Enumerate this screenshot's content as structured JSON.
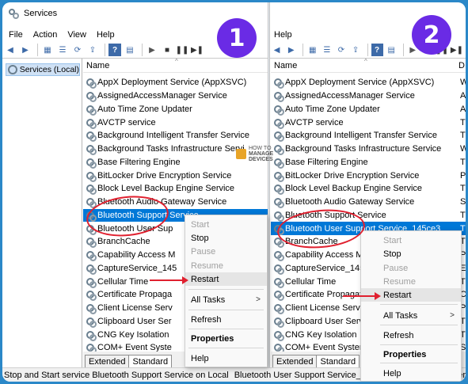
{
  "window": {
    "title": "Services"
  },
  "menu": [
    "File",
    "Action",
    "View",
    "Help"
  ],
  "menu_right": [
    "Help"
  ],
  "tree": {
    "root": "Services (Local)"
  },
  "column": {
    "name": "Name",
    "desc_initial": "D"
  },
  "services_left": [
    "AppX Deployment Service (AppXSVC)",
    "AssignedAccessManager Service",
    "Auto Time Zone Updater",
    "AVCTP service",
    "Background Intelligent Transfer Service",
    "Background Tasks Infrastructure Servi",
    "Base Filtering Engine",
    "BitLocker Drive Encryption Service",
    "Block Level Backup Engine Service",
    "Bluetooth Audio Gateway Service",
    "Bluetooth Support Service",
    "Bluetooth User Sup",
    "BranchCache",
    "Capability Access M",
    "CaptureService_145",
    "Cellular Time",
    "Certificate Propaga",
    "Client License Serv",
    "Clipboard User Ser",
    "CNG Key Isolation",
    "COM+ Event Syste"
  ],
  "services_right": [
    "AppX Deployment Service (AppXSVC)",
    "AssignedAccessManager Service",
    "Auto Time Zone Updater",
    "AVCTP service",
    "Background Intelligent Transfer Service",
    "Background Tasks Infrastructure Service",
    "Base Filtering Engine",
    "BitLocker Drive Encryption Service",
    "Block Level Backup Engine Service",
    "Bluetooth Audio Gateway Service",
    "Bluetooth Support Service",
    "Bluetooth User Support Service_145ce3",
    "BranchCache",
    "Capability Access M",
    "CaptureService_145",
    "Cellular Time",
    "Certificate Propagati",
    "Client License Serv",
    "Clipboard User Serv",
    "CNG Key Isolation",
    "COM+ Event System"
  ],
  "desc_right": [
    "W",
    "A",
    "A",
    "T",
    "T",
    "W",
    "T",
    "P",
    "T",
    "S",
    "T",
    "T",
    "T",
    "P",
    "E",
    "T",
    "C",
    "P",
    "T",
    "T",
    "S"
  ],
  "context_menu": {
    "start": "Start",
    "stop": "Stop",
    "pause": "Pause",
    "resume": "Resume",
    "restart": "Restart",
    "all_tasks": "All Tasks",
    "refresh": "Refresh",
    "properties": "Properties",
    "help": "Help"
  },
  "tabs": {
    "extended": "Extended",
    "standard": "Standard"
  },
  "status": {
    "left": "Stop and Start service Bluetooth Support Service on Local Computer",
    "right": "Bluetooth User Support Service_145ce3 on Local Computer"
  },
  "badges": {
    "one": "1",
    "two": "2"
  },
  "watermark": {
    "how": "HOW TO",
    "manage": "MANAGE",
    "devices": "DEVICES"
  },
  "colors": {
    "accent": "#6a2be5",
    "selection": "#0078d7",
    "annotation": "#e0202f",
    "border": "#2b88c8"
  },
  "icons": [
    "services-icon",
    "back-arrow-icon",
    "forward-arrow-icon",
    "play-icon",
    "stop-icon",
    "pause-icon",
    "restart-icon",
    "gear-icon"
  ]
}
